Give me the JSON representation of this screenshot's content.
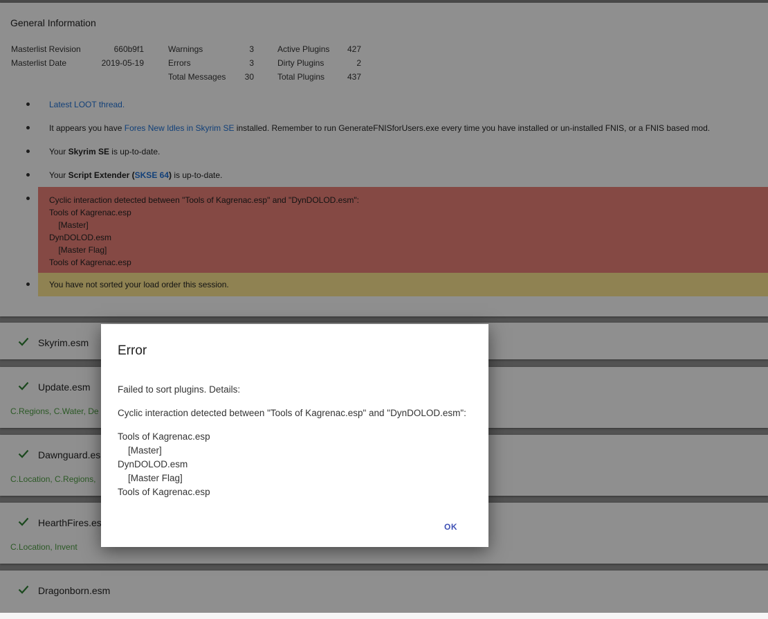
{
  "general": {
    "title": "General Information",
    "stats": {
      "masterlist_revision_label": "Masterlist Revision",
      "masterlist_revision_value": "660b9f1",
      "masterlist_date_label": "Masterlist Date",
      "masterlist_date_value": "2019-05-19",
      "warnings_label": "Warnings",
      "warnings_value": "3",
      "errors_label": "Errors",
      "errors_value": "3",
      "total_messages_label": "Total Messages",
      "total_messages_value": "30",
      "active_plugins_label": "Active Plugins",
      "active_plugins_value": "427",
      "dirty_plugins_label": "Dirty Plugins",
      "dirty_plugins_value": "2",
      "total_plugins_label": "Total Plugins",
      "total_plugins_value": "437"
    },
    "messages": {
      "thread_link": "Latest LOOT thread.",
      "fnis_prefix": "It appears you have ",
      "fnis_link": "Fores New Idles in Skyrim SE",
      "fnis_suffix": " installed. Remember to run GenerateFNISforUsers.exe every time you have installed or un-installed FNIS, or a FNIS based mod.",
      "game_prefix": "Your ",
      "game_name": "Skyrim SE",
      "game_suffix": " is up-to-date.",
      "se_prefix": "Your ",
      "se_name": "Script Extender",
      "se_open": " (",
      "se_link": "SKSE 64",
      "se_close": ")",
      "se_suffix": " is up-to-date.",
      "cyclic_lines": "Cyclic interaction detected between \"Tools of Kagrenac.esp\" and \"DynDOLOD.esm\":\nTools of Kagrenac.esp\n    [Master]\nDynDOLOD.esm\n    [Master Flag]\nTools of Kagrenac.esp",
      "unsorted": "You have not sorted your load order this session."
    }
  },
  "plugins": [
    {
      "name": "Skyrim.esm",
      "tags": ""
    },
    {
      "name": "Update.esm",
      "tags": "C.Regions, C.Water, De"
    },
    {
      "name": "Dawnguard.esm",
      "tags": "C.Location, C.Regions,"
    },
    {
      "name": "HearthFires.esm",
      "tags": "C.Location, Invent"
    },
    {
      "name": "Dragonborn.esm",
      "tags": ""
    }
  ],
  "dialog": {
    "title": "Error",
    "intro": "Failed to sort plugins. Details:",
    "cyclic": "Cyclic interaction detected between \"Tools of Kagrenac.esp\" and \"DynDOLOD.esm\":",
    "chain": "Tools of Kagrenac.esp\n    [Master]\nDynDOLOD.esm\n    [Master Flag]\nTools of Kagrenac.esp",
    "ok_label": "OK"
  },
  "colors": {
    "link": "#1f6fd0",
    "error_bg": "#e57e76",
    "warn_bg": "#f6e08e",
    "check": "#2e7d32",
    "tags": "#4c9a42",
    "ok_button": "#3f51b5"
  }
}
